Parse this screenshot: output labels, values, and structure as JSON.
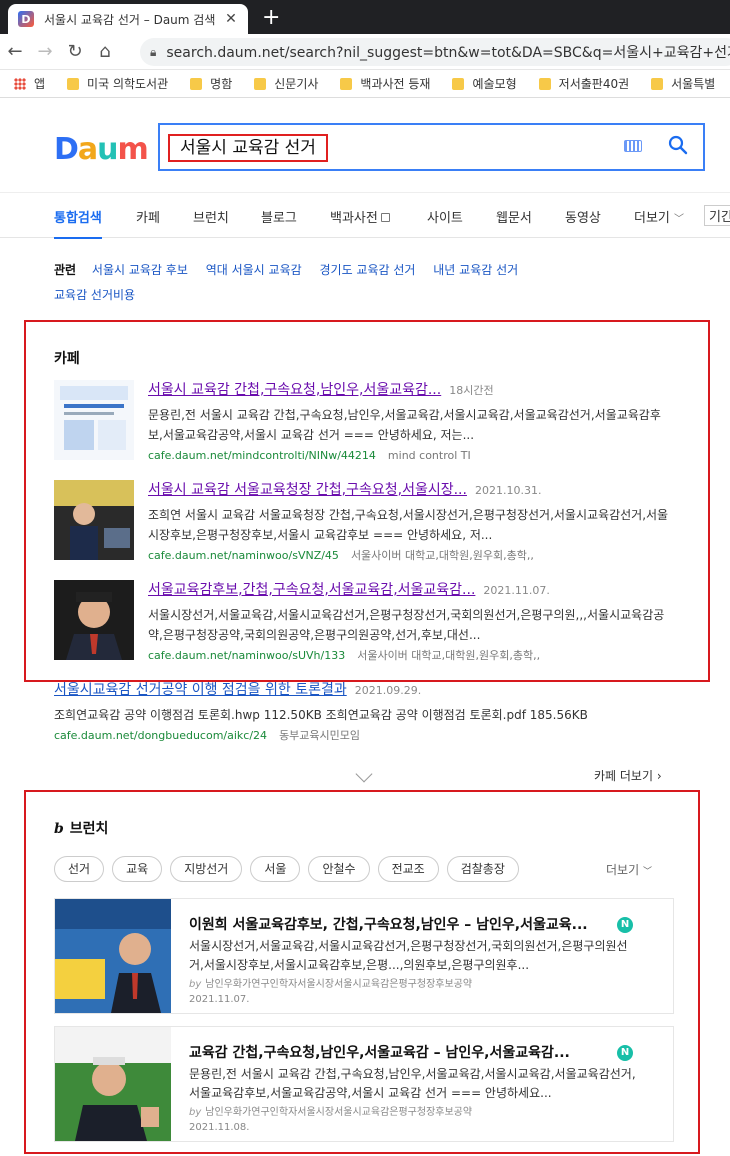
{
  "browser": {
    "tab_title": "서울시 교육감 선거 – Daum 검색",
    "tab_close": "✕",
    "newtab": "+",
    "url": "search.daum.net/search?nil_suggest=btn&w=tot&DA=SBC&q=서울시+교육감+선거",
    "bookmarks": [
      "앱",
      "미국 의학도서관",
      "명함",
      "신문기사",
      "백과사전 등재",
      "예술모형",
      "저서출판40권",
      "서울특별"
    ]
  },
  "header": {
    "logo": [
      "D",
      "a",
      "u",
      "m"
    ],
    "query": "서울시 교육감 선거"
  },
  "tabs": [
    {
      "label": "통합검색",
      "active": true
    },
    {
      "label": "카페"
    },
    {
      "label": "브런치"
    },
    {
      "label": "블로그"
    },
    {
      "label": "백과사전"
    },
    {
      "label": "사이트"
    },
    {
      "label": "웹문서"
    },
    {
      "label": "동영상"
    },
    {
      "label": "더보기"
    },
    {
      "label": "기간"
    }
  ],
  "related": {
    "label": "관련",
    "items": [
      "서울시 교육감 후보",
      "역대 서울시 교육감",
      "경기도 교육감 선거",
      "내년 교육감 선거",
      "교육감 선거비용"
    ]
  },
  "cafe": {
    "title": "카페",
    "items": [
      {
        "title": "서울시 교육감 간첩,구속요청,남인우,서울교육감...",
        "date": "18시간전",
        "desc": "문용린,전 서울시 교육감 간첩,구속요청,남인우,서울교육감,서울시교육감,서울교육감선거,서울교육감후보,서울교육감공약,서울시 교육감 선거 === 안녕하세요, 저는...",
        "url": "cafe.daum.net/mindcontrolti/NINw/44214",
        "source": "mind control TI"
      },
      {
        "title": "서울시 교육감 서울교육청장 간첩,구속요청,서울시장...",
        "date": "2021.10.31.",
        "desc": "조희연 서울시 교육감 서울교육청장 간첩,구속요청,서울시장선거,은평구청장선거,서울시교육감선거,서울시장후보,은평구청장후보,서울시 교육감후보 === 안녕하세요, 저...",
        "url": "cafe.daum.net/naminwoo/sVNZ/45",
        "source": "서울사이버 대학교,대학원,원우회,총학,,"
      },
      {
        "title": "서울교육감후보,간첩,구속요청,서울교육감,서울교육감...",
        "date": "2021.11.07.",
        "desc": "서울시장선거,서울교육감,서울시교육감선거,은평구청장선거,국회의원선거,은평구의원,,,서울시교육감공약,은평구청장공약,국회의원공약,은평구의원공약,선거,후보,대선...",
        "url": "cafe.daum.net/naminwoo/sUVh/133",
        "source": "서울사이버 대학교,대학원,원우회,총학,,"
      }
    ],
    "extra": {
      "title": "서울시교육감 선거공약 이행 점검을 위한 토론결과",
      "date": "2021.09.29.",
      "desc": "조희연교육감 공약 이행점검 토론회.hwp 112.50KB 조희연교육감 공약 이행점검 토론회.pdf 185.56KB",
      "url": "cafe.daum.net/dongbueducom/aikc/24",
      "source": "동부교육시민모임"
    },
    "more": "카페 더보기 ›"
  },
  "brunch": {
    "title": "브런치",
    "logo_icon": "b",
    "chips": [
      "선거",
      "교육",
      "지방선거",
      "서울",
      "안철수",
      "전교조",
      "검찰총장"
    ],
    "more": "더보기",
    "badge": "N",
    "by": "by",
    "cards": [
      {
        "title": "이원희 서울교육감후보, 간첩,구속요청,남인우 – 남인우,서울교육...",
        "desc": "서울시장선거,서울교육감,서울시교육감선거,은평구청장선거,국회의원선거,은평구의원선거,서울시장후보,서울시교육감후보,은평...,의원후보,은평구의원후...",
        "meta": "남인우화가연구인학자서울시장서울시교육감은평구청장후보공약",
        "date": "2021.11.07."
      },
      {
        "title": "교육감 간첩,구속요청,남인우,서울교육감 – 남인우,서울교육감...",
        "desc": "문용린,전 서울시 교육감 간첩,구속요청,남인우,서울교육감,서울시교육감,서울교육감선거,서울교육감후보,서울교육감공약,서울시 교육감 선거 === 안녕하세요...",
        "meta": "남인우화가연구인학자서울시장서울시교육감은평구청장후보공약",
        "date": "2021.11.08."
      }
    ]
  }
}
